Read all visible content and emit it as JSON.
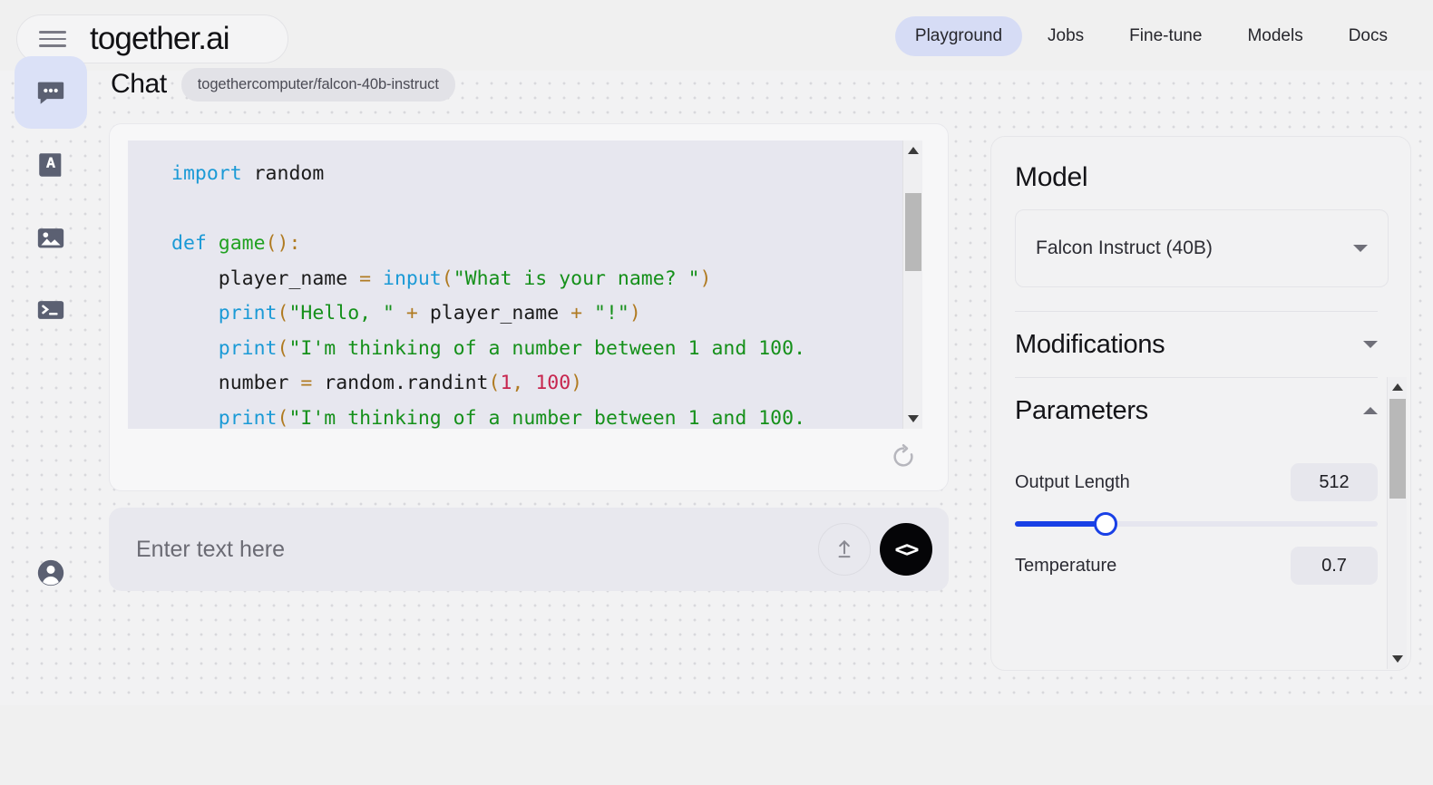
{
  "brand": {
    "logo_text": "together.ai",
    "menu_icon": "hamburger-menu-icon"
  },
  "top_nav": {
    "items": [
      {
        "label": "Playground",
        "active": true
      },
      {
        "label": "Jobs",
        "active": false
      },
      {
        "label": "Fine-tune",
        "active": false
      },
      {
        "label": "Models",
        "active": false
      },
      {
        "label": "Docs",
        "active": false
      }
    ]
  },
  "sidebar": {
    "items": [
      {
        "icon": "chat-bubble-icon",
        "name": "chat",
        "active": true
      },
      {
        "icon": "book-language-icon",
        "name": "language",
        "active": false
      },
      {
        "icon": "image-icon",
        "name": "image",
        "active": false
      },
      {
        "icon": "terminal-icon",
        "name": "terminal",
        "active": false
      }
    ],
    "account": {
      "icon": "user-avatar-icon",
      "name": "account"
    }
  },
  "chat": {
    "title": "Chat",
    "model_badge": "togethercomputer/falcon-40b-instruct",
    "regenerate_icon": "refresh-icon",
    "code_lines": [
      [
        {
          "t": "import",
          "c": "kw"
        },
        {
          "t": " random",
          "c": "pl"
        }
      ],
      [
        {
          "t": "",
          "c": "pl"
        }
      ],
      [
        {
          "t": "def",
          "c": "kw"
        },
        {
          "t": " ",
          "c": "pl"
        },
        {
          "t": "game",
          "c": "fn"
        },
        {
          "t": "():",
          "c": "op"
        }
      ],
      [
        {
          "t": "    player_name ",
          "c": "pl"
        },
        {
          "t": "=",
          "c": "op"
        },
        {
          "t": " ",
          "c": "pl"
        },
        {
          "t": "input",
          "c": "call"
        },
        {
          "t": "(",
          "c": "op"
        },
        {
          "t": "\"What is your name? \"",
          "c": "str"
        },
        {
          "t": ")",
          "c": "op"
        }
      ],
      [
        {
          "t": "    ",
          "c": "pl"
        },
        {
          "t": "print",
          "c": "call"
        },
        {
          "t": "(",
          "c": "op"
        },
        {
          "t": "\"Hello, \"",
          "c": "str"
        },
        {
          "t": " + ",
          "c": "op"
        },
        {
          "t": "player_name",
          "c": "pl"
        },
        {
          "t": " + ",
          "c": "op"
        },
        {
          "t": "\"!\"",
          "c": "str"
        },
        {
          "t": ")",
          "c": "op"
        }
      ],
      [
        {
          "t": "    ",
          "c": "pl"
        },
        {
          "t": "print",
          "c": "call"
        },
        {
          "t": "(",
          "c": "op"
        },
        {
          "t": "\"I'm thinking of a number between 1 and 100.",
          "c": "str"
        }
      ],
      [
        {
          "t": "    number ",
          "c": "pl"
        },
        {
          "t": "=",
          "c": "op"
        },
        {
          "t": " random.randint",
          "c": "pl"
        },
        {
          "t": "(",
          "c": "op"
        },
        {
          "t": "1",
          "c": "num"
        },
        {
          "t": ", ",
          "c": "op"
        },
        {
          "t": "100",
          "c": "num"
        },
        {
          "t": ")",
          "c": "op"
        }
      ],
      [
        {
          "t": "    ",
          "c": "pl"
        },
        {
          "t": "print",
          "c": "call"
        },
        {
          "t": "(",
          "c": "op"
        },
        {
          "t": "\"I'm thinking of a number between 1 and 100.",
          "c": "str"
        }
      ]
    ],
    "prompt_placeholder": "Enter text here",
    "prompt_value": "",
    "upload_icon": "upload-arrow-icon",
    "send_icon": "code-brackets-icon",
    "send_label": "<>"
  },
  "settings": {
    "model_heading": "Model",
    "model_selected": "Falcon Instruct (40B)",
    "sections": [
      {
        "label": "Modifications",
        "expanded": false
      },
      {
        "label": "Parameters",
        "expanded": true
      }
    ],
    "parameters": [
      {
        "label": "Output Length",
        "value": "512",
        "slider_percent": 25
      },
      {
        "label": "Temperature",
        "value": "0.7"
      }
    ]
  },
  "colors": {
    "accent_blue": "#1940e6",
    "nav_active_bg": "#d6dcf5",
    "sidebar_active_bg": "#dbe1f7",
    "send_button_bg": "#050507",
    "code_bg": "#e7e7ef",
    "canvas_bg": "#f2f2f3",
    "page_bg": "#f0f0f0"
  }
}
